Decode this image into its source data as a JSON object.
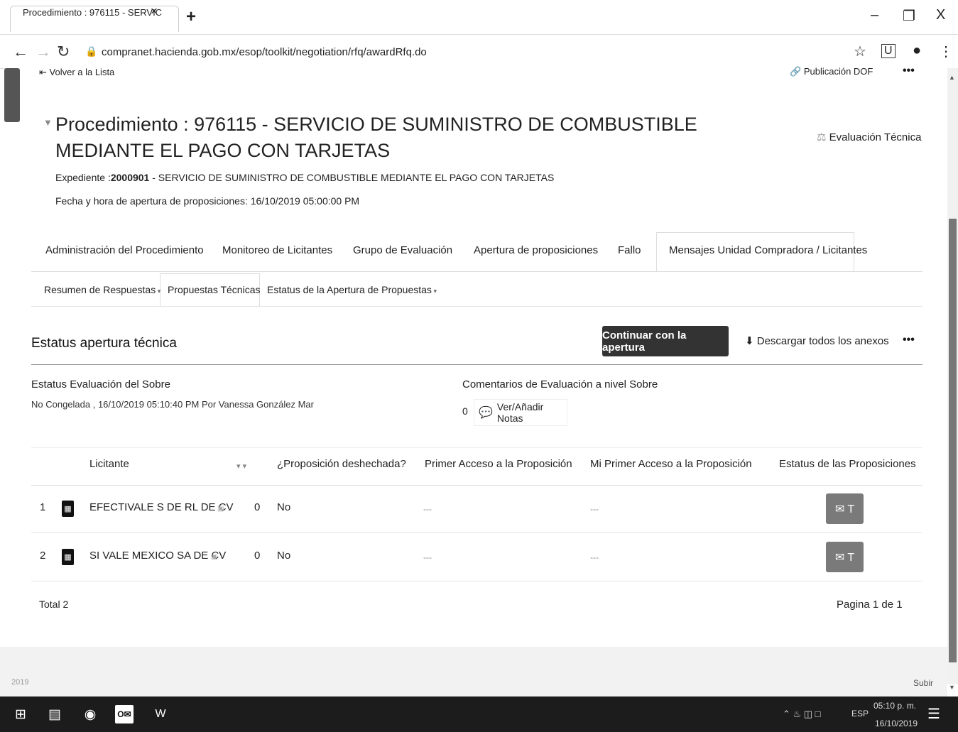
{
  "browser": {
    "tab_title": "Procedimiento : 976115 - SERVIC",
    "tab_close": "×",
    "new_tab": "+",
    "minimize": "–",
    "restore": "❐",
    "close": "X",
    "url": "compranet.hacienda.gob.mx/esop/toolkit/negotiation/rfq/awardRfq.do"
  },
  "header": {
    "back_link": "Volver a la Lista",
    "publication_link": "Publicación DOF",
    "title": "Procedimiento : 976115 - SERVICIO DE SUMINISTRO DE COMBUSTIBLE MEDIANTE EL PAGO CON TARJETAS",
    "evaluation_link": "Evaluación Técnica",
    "expediente_label": "Expediente :",
    "expediente_number": "2000901",
    "expediente_desc": " - SERVICIO DE SUMINISTRO DE COMBUSTIBLE MEDIANTE EL PAGO CON TARJETAS",
    "fecha_label": "Fecha y hora de apertura de proposiciones:",
    "fecha_value": "16/10/2019 05:00:00 PM"
  },
  "tabs_primary": [
    "Administración del Procedimiento",
    "Monitoreo de Licitantes",
    "Grupo de Evaluación",
    "Apertura de proposiciones",
    "Fallo",
    "Mensajes Unidad Compradora / Licitantes"
  ],
  "tabs_secondary": [
    "Resumen de Respuestas",
    "Propuestas Técnicas",
    "Estatus de la Apertura de Propuestas"
  ],
  "section": {
    "title": "Estatus apertura técnica",
    "continue_button": "Continuar con la apertura",
    "download_button": "Descargar todos los anexos",
    "status_label": "Estatus Evaluación del Sobre",
    "status_value": "No Congelada , 16/10/2019 05:10:40 PM  Por Vanessa González Mar",
    "comments_label": "Comentarios de Evaluación a nivel Sobre",
    "notes_count": "0",
    "notes_button": "Ver/Añadir Notas"
  },
  "table": {
    "headers": {
      "bidder": "Licitante",
      "discarded": "¿Proposición deshechada?",
      "first_access": "Primer Acceso a la Proposición",
      "my_first_access": "Mi Primer Acceso a la Proposición",
      "status": "Estatus de las Proposiciones"
    },
    "rows": [
      {
        "index": "1",
        "bidder": "EFECTIVALE S DE RL DE CV",
        "count": "0",
        "discarded": "No",
        "first_access": "---",
        "my_first_access": "---"
      },
      {
        "index": "2",
        "bidder": "SI VALE MEXICO SA DE CV",
        "count": "0",
        "discarded": "No",
        "first_access": "---",
        "my_first_access": "---"
      }
    ],
    "total": "Total 2",
    "pagination": "Pagina 1 de 1"
  },
  "footer": {
    "year": "2019",
    "subir": "Subir"
  },
  "taskbar": {
    "lang": "ESP",
    "time": "05:10 p. m.",
    "date": "16/10/2019"
  }
}
